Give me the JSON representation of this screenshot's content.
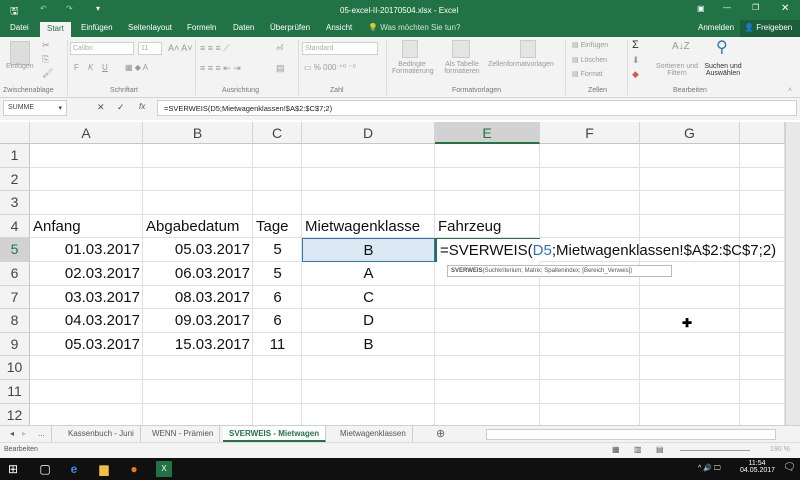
{
  "title": "05-excel-II-20170504.xlsx - Excel",
  "tabs": [
    "Datei",
    "Start",
    "Einfügen",
    "Seitenlayout",
    "Formeln",
    "Daten",
    "Überprüfen",
    "Ansicht"
  ],
  "tellme": "Was möchten Sie tun?",
  "signin": "Anmelden",
  "share": "Freigeben",
  "ribbon": {
    "paste": "Einfügen",
    "clipboard": "Zwischenablage",
    "font": "Calibri",
    "size": "11",
    "font_group": "Schriftart",
    "font_btns": [
      "F",
      "K",
      "U"
    ],
    "align_group": "Ausrichtung",
    "numfmt": "Standard",
    "number_group": "Zahl",
    "cond1": "Bedingte",
    "cond2": "Formatierung",
    "table1": "Als Tabelle",
    "table2": "formatieren",
    "cellstyles": "Zellenformatvorlagen",
    "styles_group": "Formatvorlagen",
    "insert": "Einfügen",
    "delete": "Löschen",
    "format": "Format",
    "cells_group": "Zellen",
    "sort1": "Sortieren und",
    "sort2": "Filtern",
    "find1": "Suchen und",
    "find2": "Auswählen",
    "edit_group": "Bearbeiten"
  },
  "namebox": "SUMME",
  "formula": "=SVERWEIS(D5;Mietwagenklassen!$A$2:$C$7;2)",
  "columns": [
    "A",
    "B",
    "C",
    "D",
    "E",
    "F",
    "G"
  ],
  "rows": [
    "1",
    "2",
    "3",
    "4",
    "5",
    "6",
    "7",
    "8",
    "9",
    "10",
    "11",
    "12"
  ],
  "headers": {
    "a": "Anfang",
    "b": "Abgabedatum",
    "c": "Tage",
    "d": "Mietwagenklasse",
    "e": "Fahrzeug"
  },
  "data": [
    {
      "a": "01.03.2017",
      "b": "05.03.2017",
      "c": "5",
      "d": "B"
    },
    {
      "a": "02.03.2017",
      "b": "06.03.2017",
      "c": "5",
      "d": "A"
    },
    {
      "a": "03.03.2017",
      "b": "08.03.2017",
      "c": "6",
      "d": "C"
    },
    {
      "a": "04.03.2017",
      "b": "09.03.2017",
      "c": "6",
      "d": "D"
    },
    {
      "a": "05.03.2017",
      "b": "15.03.2017",
      "c": "11",
      "d": "B"
    }
  ],
  "edit": {
    "pre": "=SVERWEIS(",
    "ref": "D5",
    "post": ";Mietwagenklassen!$A$2:$C$7;2)"
  },
  "tooltip": {
    "fn": "SVERWEIS",
    "args": "(Suchkriterium; Matrix; Spaltenindex; [Bereich_Verweis])"
  },
  "sheets": [
    "...",
    "Kassenbuch - Juni",
    "WENN - Prämien",
    "SVERWEIS - Mietwagen",
    "Mietwagenklassen"
  ],
  "status": "Bearbeiten",
  "zoom": "190 %",
  "clock": {
    "time": "11:54",
    "date": "04.05.2017"
  },
  "colors": {
    "accent": "#217346",
    "ref": "#2e75b6"
  }
}
